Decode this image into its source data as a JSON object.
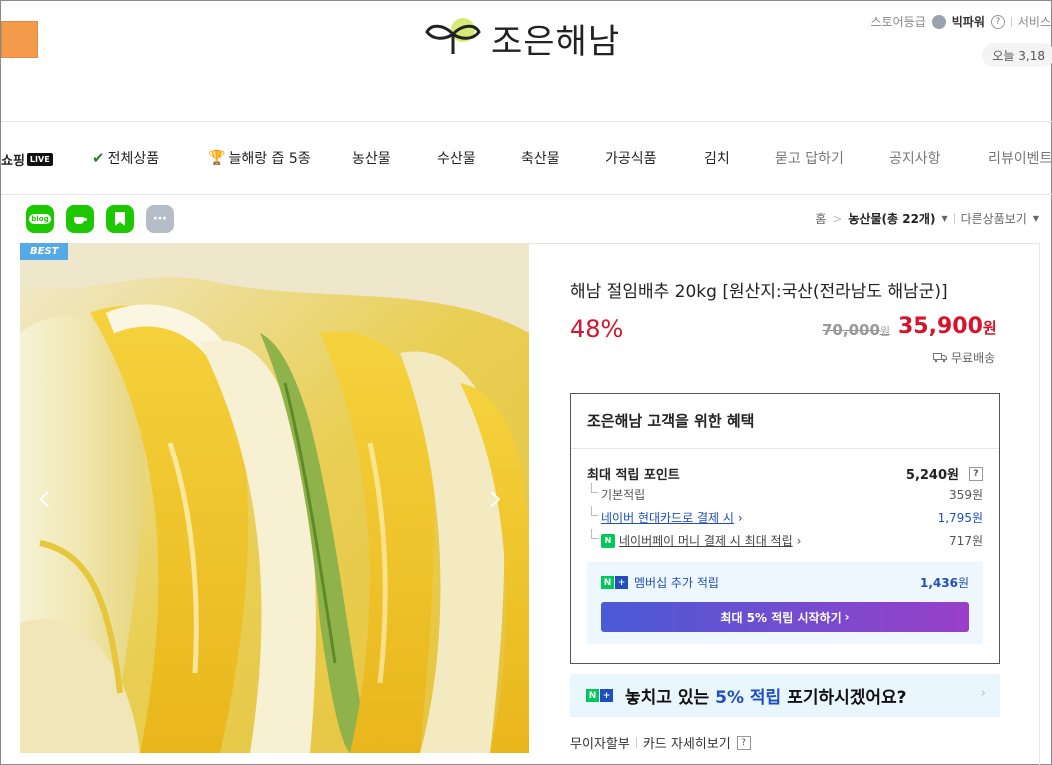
{
  "header": {
    "logo_text": "조은해남",
    "store_grade_label": "스토어등급",
    "grade_name": "빅파워",
    "grade_help": "?",
    "service_label": "서비스",
    "today_label": "오늘 3,18"
  },
  "nav": {
    "live_label": "쇼핑",
    "live_tag": "LIVE",
    "items": [
      {
        "label": "전체상품"
      },
      {
        "label": "늘해랑 즙 5종"
      },
      {
        "label": "농산물"
      },
      {
        "label": "수산물"
      },
      {
        "label": "축산물"
      },
      {
        "label": "가공식품"
      },
      {
        "label": "김치"
      },
      {
        "label": "묻고 답하기"
      },
      {
        "label": "공지사항"
      },
      {
        "label": "리뷰이벤트"
      }
    ]
  },
  "share": {
    "blog_label": "blog"
  },
  "breadcrumb": {
    "home": "홈",
    "category": "농산물(총 22개)",
    "other_products": "다른상품보기"
  },
  "product": {
    "badge": "BEST",
    "title": "해남 절임배추 20kg [원산지:국산(전라남도 해남군)]",
    "discount": "48%",
    "original_price": "70,000",
    "original_price_unit": "원",
    "sale_price": "35,900",
    "sale_price_unit": "원",
    "shipping": "무료배송"
  },
  "benefit": {
    "title": "조은해남 고객을 위한 혜택",
    "max_points_label": "최대 적립 포인트",
    "max_points_value": "5,240원",
    "basic_label": "기본적립",
    "basic_value": "359원",
    "card_label": "네이버 현대카드로 결제 시",
    "card_value": "1,795원",
    "npay_label": "네이버페이 머니 결제 시 최대 적립",
    "npay_value": "717원",
    "membership_label": "멤버십 추가 적립",
    "membership_value": "1,436",
    "membership_unit": "원",
    "cta_label": "최대 5% 적립 시작하기"
  },
  "miss_banner": {
    "prefix": "놓치고 있는",
    "highlight": "5% 적립",
    "suffix": "포기하시겠어요?"
  },
  "installment": {
    "label": "무이자할부",
    "card_detail": "카드 자세히보기",
    "help": "?"
  }
}
